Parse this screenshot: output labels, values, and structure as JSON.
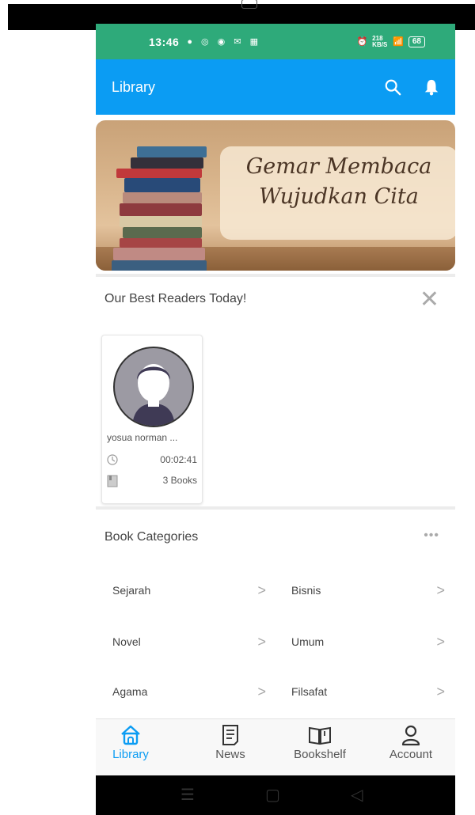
{
  "status_bar": {
    "time": "13:46",
    "speed": "218 KB/S",
    "battery": "68"
  },
  "app_bar": {
    "title": "Library"
  },
  "banner": {
    "line1": "Gemar Membaca",
    "line2": "Wujudkan Cita"
  },
  "readers": {
    "title": "Our Best Readers Today!",
    "items": [
      {
        "name": "yosua norman ...",
        "time": "00:02:41",
        "books": "3 Books"
      }
    ]
  },
  "categories": {
    "title": "Book Categories",
    "more": "•••",
    "items": [
      {
        "label": "Sejarah"
      },
      {
        "label": "Bisnis"
      },
      {
        "label": "Novel"
      },
      {
        "label": "Umum"
      },
      {
        "label": "Agama"
      },
      {
        "label": "Filsafat"
      }
    ]
  },
  "bottom_nav": [
    {
      "label": "Library",
      "icon": "library-icon",
      "active": true
    },
    {
      "label": "News",
      "icon": "news-icon"
    },
    {
      "label": "Bookshelf",
      "icon": "bookshelf-icon"
    },
    {
      "label": "Account",
      "icon": "account-icon"
    }
  ],
  "colors": {
    "status_bar": "#2eaa7a",
    "app_bar": "#0b9cf3",
    "accent": "#0b9cf3"
  }
}
